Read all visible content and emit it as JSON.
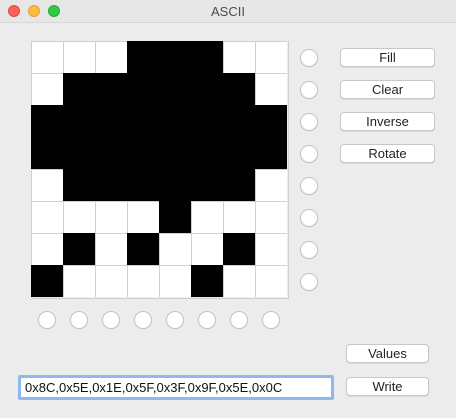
{
  "window": {
    "title": "ASCII"
  },
  "grid": [
    [
      0,
      0,
      0,
      1,
      1,
      1,
      0,
      0
    ],
    [
      0,
      1,
      1,
      1,
      1,
      1,
      1,
      0
    ],
    [
      1,
      1,
      1,
      1,
      1,
      1,
      1,
      1
    ],
    [
      1,
      1,
      1,
      1,
      1,
      1,
      1,
      1
    ],
    [
      0,
      1,
      1,
      1,
      1,
      1,
      1,
      0
    ],
    [
      0,
      0,
      0,
      0,
      1,
      0,
      0,
      0
    ],
    [
      0,
      1,
      0,
      1,
      0,
      0,
      1,
      0
    ],
    [
      1,
      0,
      0,
      0,
      0,
      1,
      0,
      0
    ]
  ],
  "colors": {
    "pixel_on": "#000000",
    "pixel_off": "#ffffff",
    "close": "#fc605c",
    "minimize": "#fdbc40",
    "maximize": "#34c84a",
    "focus_ring": "#8db9ee"
  },
  "actions": {
    "fill_label": "Fill",
    "clear_label": "Clear",
    "inverse_label": "Inverse",
    "rotate_label": "Rotate",
    "values_label": "Values",
    "write_label": "Write"
  },
  "hex_input": {
    "value": "0x8C,0x5E,0x1E,0x5F,0x3F,0x9F,0x5E,0x0C"
  }
}
